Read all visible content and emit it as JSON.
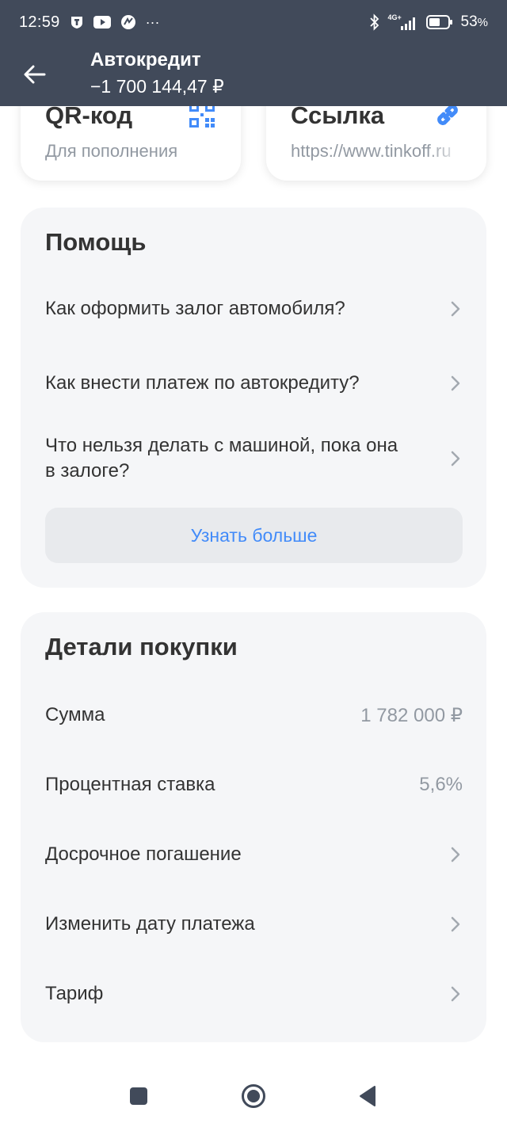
{
  "status_bar": {
    "time": "12:59",
    "network": "4G+",
    "battery": "53",
    "battery_suffix": "%",
    "more": "···"
  },
  "app_bar": {
    "title": "Автокредит",
    "subtitle": "−1 700 144,47 ₽"
  },
  "tiles": [
    {
      "title": "QR-код",
      "subtitle": "Для пополнения",
      "icon": "qr-code-icon"
    },
    {
      "title": "Ссылка",
      "subtitle": "https://www.tinkoff.ru",
      "icon": "link-icon"
    }
  ],
  "help": {
    "heading": "Помощь",
    "items": [
      {
        "label": "Как оформить залог автомобиля?"
      },
      {
        "label": "Как внести платеж по автокредиту?"
      },
      {
        "label": "Что нельзя делать с машиной, пока она в залоге?"
      }
    ],
    "more_button": "Узнать больше"
  },
  "details": {
    "heading": "Детали покупки",
    "rows": [
      {
        "label": "Сумма",
        "value": "1 782 000 ₽"
      },
      {
        "label": "Процентная ставка",
        "value": "5,6%"
      },
      {
        "label": "Досрочное погашение"
      },
      {
        "label": "Изменить дату платежа"
      },
      {
        "label": "Тариф"
      }
    ]
  },
  "colors": {
    "header_bg": "#414a5a",
    "card_bg": "#f5f6f8",
    "accent_blue": "#428bf9",
    "secondary_text": "#9299a2",
    "primary_text": "#333333"
  }
}
